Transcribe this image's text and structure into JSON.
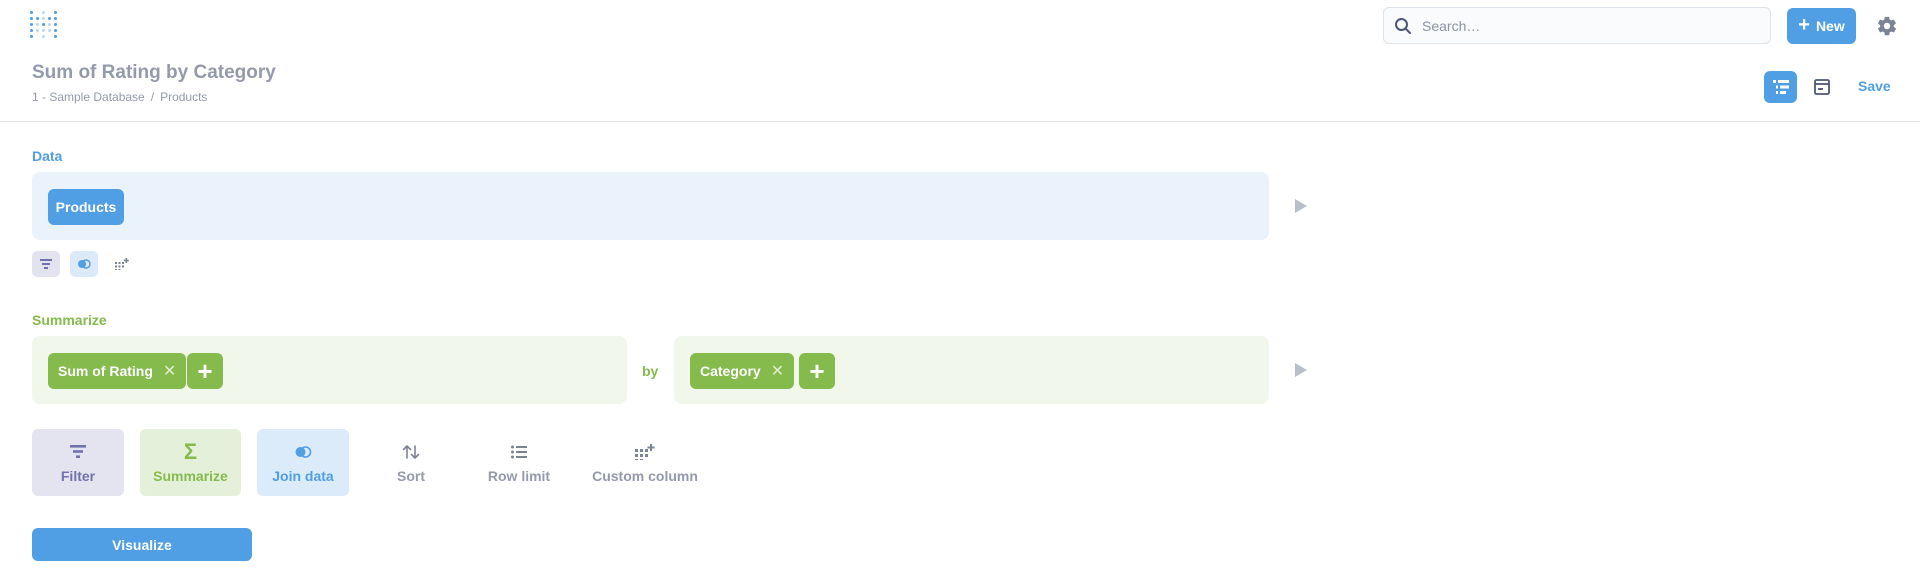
{
  "nav": {
    "search_placeholder": "Search…",
    "new_label": "New"
  },
  "header": {
    "title": "Sum of Rating by Category",
    "breadcrumb": [
      "1 - Sample Database",
      "/",
      "Products"
    ],
    "save_label": "Save"
  },
  "data_step": {
    "label": "Data",
    "table": "Products"
  },
  "summarize_step": {
    "label": "Summarize",
    "metric": "Sum of Rating",
    "by_label": "by",
    "breakout": "Category"
  },
  "actions": {
    "filter": "Filter",
    "summarize": "Summarize",
    "join": "Join data",
    "sort": "Sort",
    "row_limit": "Row limit",
    "custom_column": "Custom column"
  },
  "visualize_label": "Visualize",
  "colors": {
    "brand": "#509ee3",
    "summarize": "#84bb4c",
    "filter": "#7172ad",
    "muted": "#949aab"
  },
  "icons": {
    "logo": "metabase-logo-icon",
    "search": "search-icon",
    "new": "plus-icon",
    "settings": "gear-icon",
    "notebook": "notebook-icon",
    "sql": "sql-editor-icon",
    "run": "play-icon",
    "remove": "close-icon",
    "add": "plus-icon"
  }
}
